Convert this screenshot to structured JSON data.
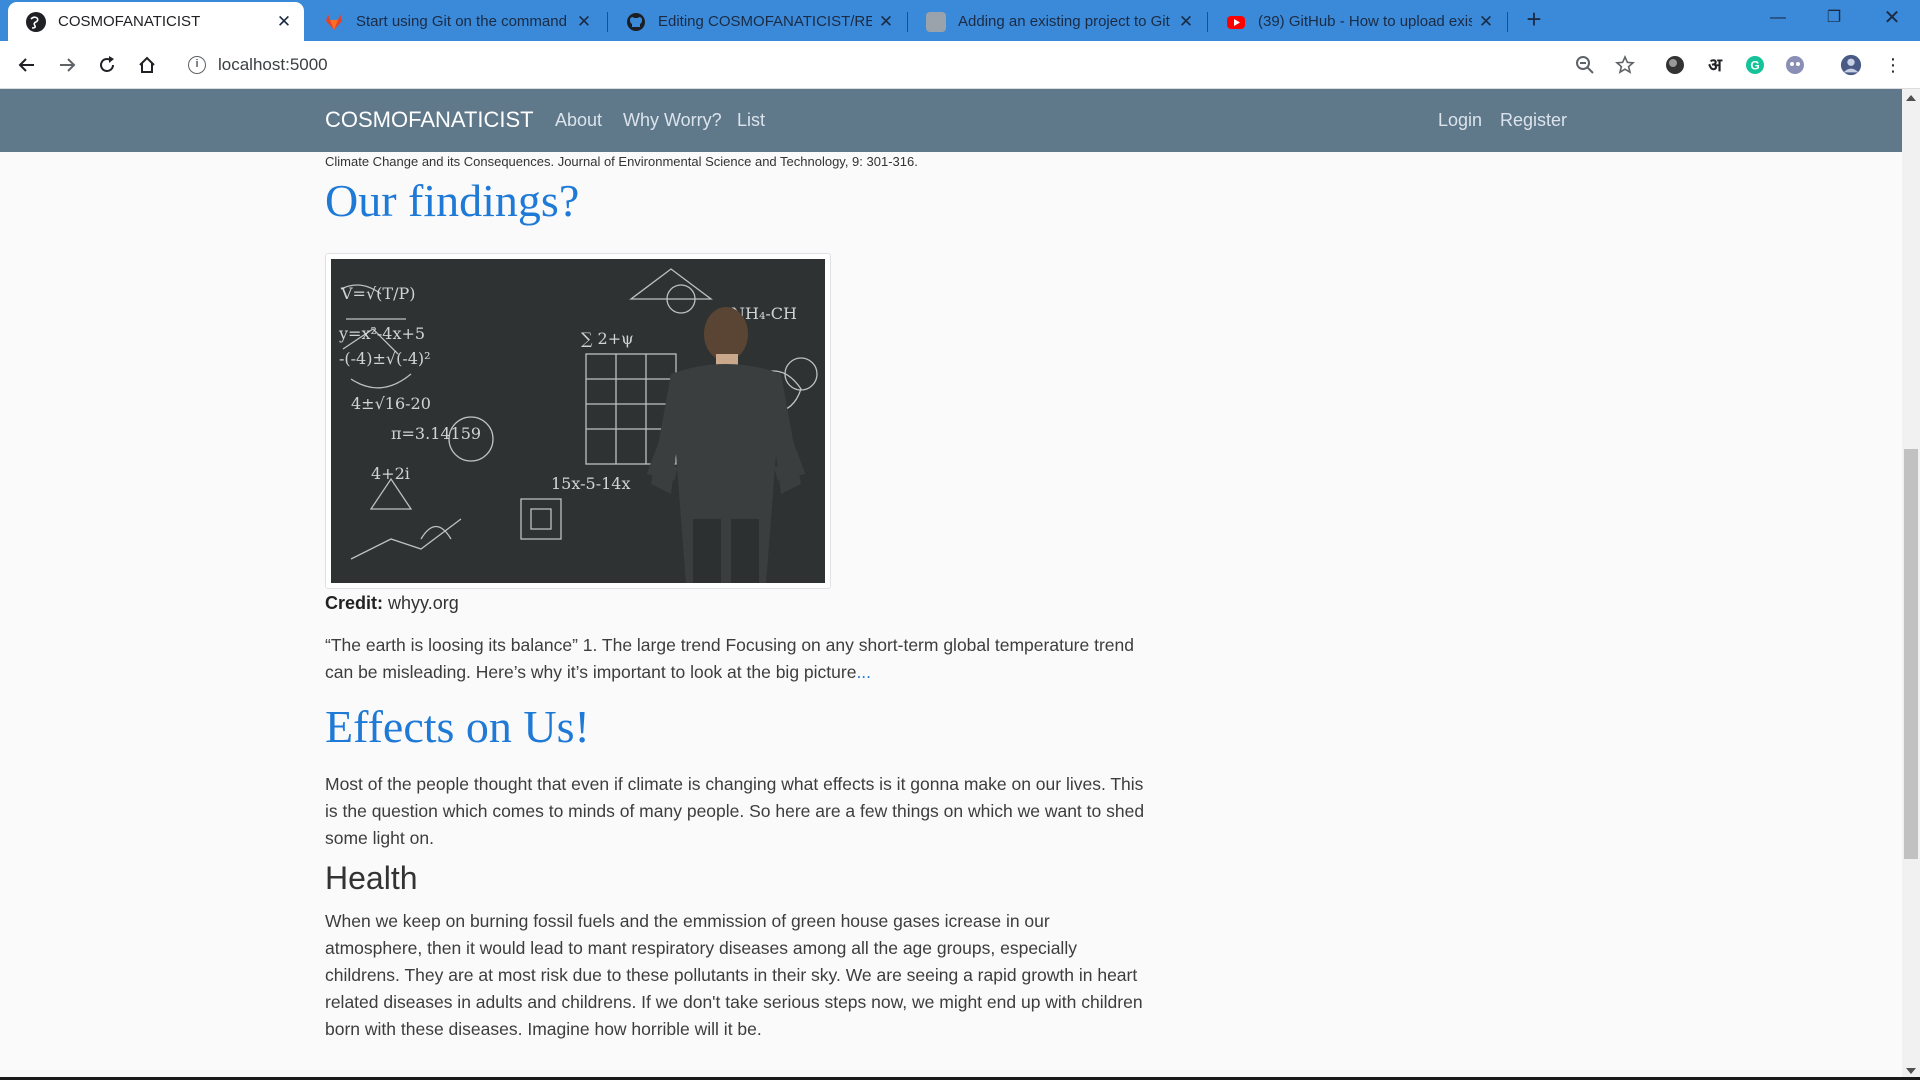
{
  "browser": {
    "tabs": [
      {
        "title": "COSMOFANATICIST",
        "icon": "globe-icon",
        "active": true
      },
      {
        "title": "Start using Git on the command",
        "icon": "gitlab-icon"
      },
      {
        "title": "Editing COSMOFANATICIST/READ",
        "icon": "github-icon"
      },
      {
        "title": "Adding an existing project to Git",
        "icon": "blog-icon"
      },
      {
        "title": "(39) GitHub - How to upload exis",
        "icon": "youtube-icon"
      }
    ],
    "new_tab": "+",
    "url": "localhost:5000",
    "accent_color": "#3b8ad9"
  },
  "navbar": {
    "brand": "COSMOFANATICIST",
    "links": [
      "About",
      "Why Worry?",
      "List"
    ],
    "auth": [
      "Login",
      "Register"
    ],
    "color": "#5f788a"
  },
  "content": {
    "citation": "Climate Change and its Consequences. Journal of Environmental Science and Technology, 9: 301-316.",
    "findings_heading": "Our findings?",
    "credit_label": "Credit:",
    "credit_source": "whyy.org",
    "findings_text": "“The earth is loosing its balance” 1. The large trend Focusing on any short-term global temperature trend can be misleading. Here’s why it’s important to look at the big picture",
    "findings_more": "...",
    "effects_heading": "Effects on Us!",
    "effects_text": "Most of the people thought that even if climate is changing what effects is it gonna make on our lives. This is the question which comes to minds of many people. So here are a few things on which we want to shed some light on.",
    "health_heading": "Health",
    "health_text": "When we keep on burning fossil fuels and the emmission of green house gases icrease in our atmosphere, then it would lead to mant respiratory diseases among all the age groups, especially childrens. They are at most risk due to these pollutants in their sky. We are seeing a rapid growth in heart related diseases in adults and childrens. If we don't take serious steps now, we might end up with children born with these diseases. Imagine how horrible will it be.",
    "heading_color": "#1e7ad6"
  }
}
